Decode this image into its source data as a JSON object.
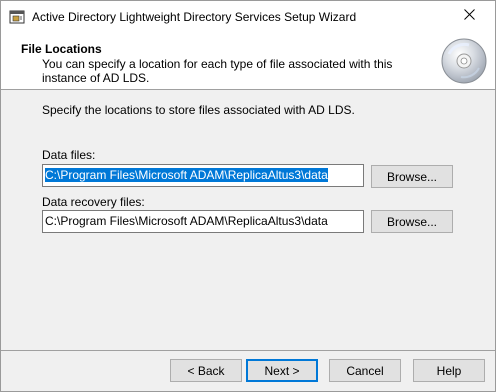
{
  "window": {
    "title": "Active Directory Lightweight Directory Services Setup Wizard"
  },
  "header": {
    "title": "File Locations",
    "description": "You can specify a location for each type of file associated with this instance of AD LDS."
  },
  "content": {
    "instruction": "Specify the locations to store files associated with AD LDS.",
    "data_files": {
      "label": "Data files:",
      "value": "C:\\Program Files\\Microsoft ADAM\\ReplicaAltus3\\data",
      "browse_label": "Browse..."
    },
    "recovery_files": {
      "label": "Data recovery files:",
      "value": "C:\\Program Files\\Microsoft ADAM\\ReplicaAltus3\\data",
      "browse_label": "Browse..."
    }
  },
  "footer": {
    "back_label": "< Back",
    "next_label": "Next >",
    "cancel_label": "Cancel",
    "help_label": "Help"
  },
  "icons": {
    "app": "server-wizard-icon",
    "header": "cd-disc-icon",
    "close": "close-icon"
  },
  "colors": {
    "selection": "#0078d7",
    "header_bg": "#ffffff",
    "body_bg": "#f0f0f0"
  }
}
